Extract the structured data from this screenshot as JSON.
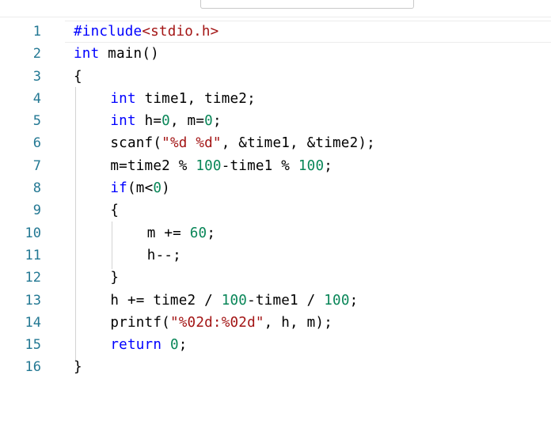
{
  "editor": {
    "lines": [
      {
        "num": "1",
        "indent": 0,
        "tokens": [
          {
            "t": "kw",
            "v": "#include"
          },
          {
            "t": "str",
            "v": "<stdio.h>"
          }
        ]
      },
      {
        "num": "2",
        "indent": 0,
        "tokens": [
          {
            "t": "kw",
            "v": "int"
          },
          {
            "t": "plain",
            "v": " main()"
          }
        ]
      },
      {
        "num": "3",
        "indent": 0,
        "tokens": [
          {
            "t": "plain",
            "v": "{"
          }
        ]
      },
      {
        "num": "4",
        "indent": 4,
        "tokens": [
          {
            "t": "kw",
            "v": "int"
          },
          {
            "t": "plain",
            "v": " time1, time2;"
          }
        ]
      },
      {
        "num": "5",
        "indent": 4,
        "tokens": [
          {
            "t": "kw",
            "v": "int"
          },
          {
            "t": "plain",
            "v": " h="
          },
          {
            "t": "num",
            "v": "0"
          },
          {
            "t": "plain",
            "v": ", m="
          },
          {
            "t": "num",
            "v": "0"
          },
          {
            "t": "plain",
            "v": ";"
          }
        ]
      },
      {
        "num": "6",
        "indent": 4,
        "tokens": [
          {
            "t": "plain",
            "v": "scanf("
          },
          {
            "t": "str",
            "v": "\"%d %d\""
          },
          {
            "t": "plain",
            "v": ", &time1, &time2);"
          }
        ]
      },
      {
        "num": "7",
        "indent": 4,
        "tokens": [
          {
            "t": "plain",
            "v": "m=time2 % "
          },
          {
            "t": "num",
            "v": "100"
          },
          {
            "t": "plain",
            "v": "-time1 % "
          },
          {
            "t": "num",
            "v": "100"
          },
          {
            "t": "plain",
            "v": ";"
          }
        ]
      },
      {
        "num": "8",
        "indent": 4,
        "tokens": [
          {
            "t": "kw",
            "v": "if"
          },
          {
            "t": "plain",
            "v": "(m<"
          },
          {
            "t": "num",
            "v": "0"
          },
          {
            "t": "plain",
            "v": ")"
          }
        ]
      },
      {
        "num": "9",
        "indent": 4,
        "tokens": [
          {
            "t": "plain",
            "v": "{"
          }
        ]
      },
      {
        "num": "10",
        "indent": 8,
        "tokens": [
          {
            "t": "plain",
            "v": "m += "
          },
          {
            "t": "num",
            "v": "60"
          },
          {
            "t": "plain",
            "v": ";"
          }
        ]
      },
      {
        "num": "11",
        "indent": 8,
        "tokens": [
          {
            "t": "plain",
            "v": "h--;"
          }
        ]
      },
      {
        "num": "12",
        "indent": 4,
        "tokens": [
          {
            "t": "plain",
            "v": "}"
          }
        ]
      },
      {
        "num": "13",
        "indent": 4,
        "tokens": [
          {
            "t": "plain",
            "v": "h += time2 / "
          },
          {
            "t": "num",
            "v": "100"
          },
          {
            "t": "plain",
            "v": "-time1 / "
          },
          {
            "t": "num",
            "v": "100"
          },
          {
            "t": "plain",
            "v": ";"
          }
        ]
      },
      {
        "num": "14",
        "indent": 4,
        "tokens": [
          {
            "t": "plain",
            "v": "printf("
          },
          {
            "t": "str",
            "v": "\"%02d:%02d\""
          },
          {
            "t": "plain",
            "v": ", h, m);"
          }
        ]
      },
      {
        "num": "15",
        "indent": 4,
        "tokens": [
          {
            "t": "kw",
            "v": "return"
          },
          {
            "t": "plain",
            "v": " "
          },
          {
            "t": "num",
            "v": "0"
          },
          {
            "t": "plain",
            "v": ";"
          }
        ]
      },
      {
        "num": "16",
        "indent": 0,
        "tokens": [
          {
            "t": "plain",
            "v": "}"
          }
        ]
      }
    ],
    "colors": {
      "keyword": "#0000ff",
      "string": "#a31515",
      "number": "#098658",
      "line_number": "#237893",
      "text": "#000000"
    }
  }
}
